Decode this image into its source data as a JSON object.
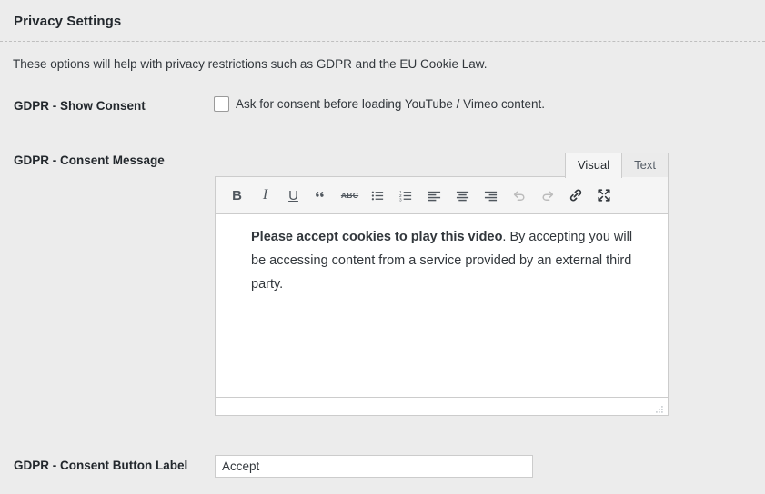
{
  "section": {
    "title": "Privacy Settings",
    "description": "These options will help with privacy restrictions such as GDPR and the EU Cookie Law."
  },
  "fields": {
    "show_consent": {
      "label": "GDPR - Show Consent",
      "checkbox_label": "Ask for consent before loading YouTube / Vimeo content.",
      "checked": false
    },
    "consent_message": {
      "label": "GDPR - Consent Message",
      "editor": {
        "tabs": [
          {
            "label": "Visual",
            "active": true
          },
          {
            "label": "Text",
            "active": false
          }
        ],
        "toolbar": [
          {
            "name": "bold-icon",
            "title": "Bold",
            "glyph": "B",
            "disabled": false
          },
          {
            "name": "italic-icon",
            "title": "Italic",
            "glyph": "I",
            "disabled": false
          },
          {
            "name": "underline-icon",
            "title": "Underline",
            "glyph": "U",
            "disabled": false
          },
          {
            "name": "blockquote-icon",
            "title": "Blockquote",
            "glyph": "“",
            "disabled": false
          },
          {
            "name": "strikethrough-icon",
            "title": "Strikethrough",
            "glyph": "ABC",
            "disabled": false
          },
          {
            "name": "bulleted-list-icon",
            "title": "Bulleted list",
            "glyph": "",
            "disabled": false
          },
          {
            "name": "numbered-list-icon",
            "title": "Numbered list",
            "glyph": "",
            "disabled": false
          },
          {
            "name": "align-left-icon",
            "title": "Align left",
            "glyph": "",
            "disabled": false
          },
          {
            "name": "align-center-icon",
            "title": "Align center",
            "glyph": "",
            "disabled": false
          },
          {
            "name": "align-right-icon",
            "title": "Align right",
            "glyph": "",
            "disabled": false
          },
          {
            "name": "undo-icon",
            "title": "Undo",
            "glyph": "",
            "disabled": true
          },
          {
            "name": "redo-icon",
            "title": "Redo",
            "glyph": "",
            "disabled": true
          },
          {
            "name": "insert-link-icon",
            "title": "Insert/edit link",
            "glyph": "",
            "disabled": false
          },
          {
            "name": "fullscreen-icon",
            "title": "Distraction-free writing mode",
            "glyph": "",
            "disabled": false
          }
        ],
        "content": {
          "bold_lead": "Please accept cookies to play this video",
          "rest": ". By accepting you will be accessing content from a service provided by an external third party."
        }
      }
    },
    "consent_button": {
      "label": "GDPR - Consent Button Label",
      "value": "Accept",
      "placeholder": ""
    }
  },
  "colors": {
    "page_background": "#ececec",
    "text": "#23282d",
    "border": "#cccccc",
    "toolbar_background": "#f5f5f5",
    "editor_background": "#ffffff",
    "icon": "#50575e",
    "icon_disabled": "#bcbcbc"
  }
}
